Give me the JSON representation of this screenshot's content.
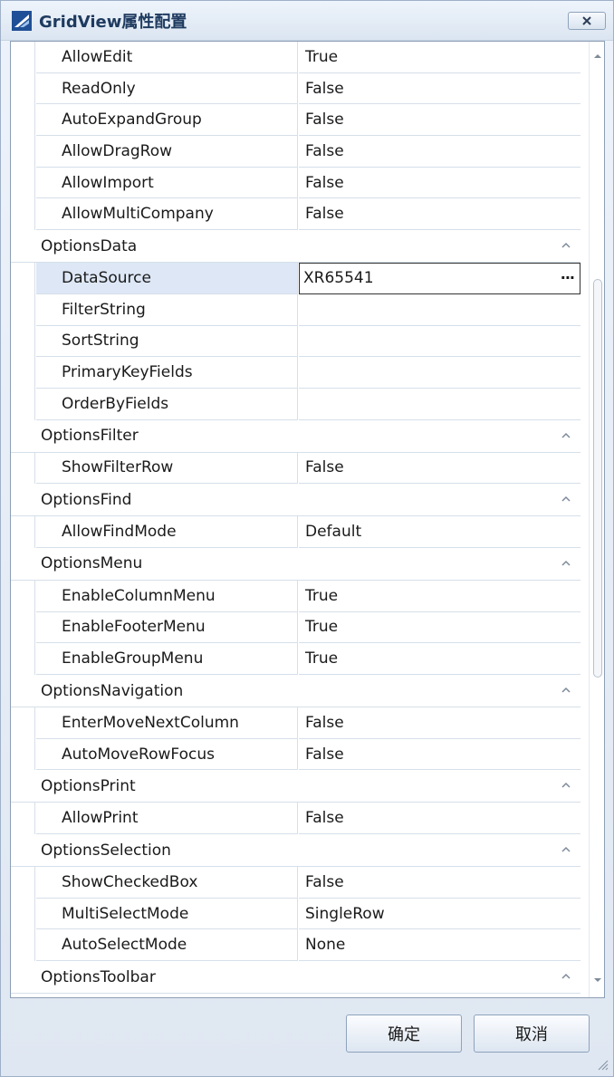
{
  "window": {
    "title": "GridView属性配置"
  },
  "grid": {
    "top_properties": [
      {
        "name": "AllowEdit",
        "value": "True"
      },
      {
        "name": "ReadOnly",
        "value": "False"
      },
      {
        "name": "AutoExpandGroup",
        "value": "False"
      },
      {
        "name": "AllowDragRow",
        "value": "False"
      },
      {
        "name": "AllowImport",
        "value": "False"
      },
      {
        "name": "AllowMultiCompany",
        "value": "False"
      }
    ],
    "categories": [
      {
        "name": "OptionsData",
        "properties": [
          {
            "name": "DataSource",
            "value": "XR65541"
          },
          {
            "name": "FilterString",
            "value": ""
          },
          {
            "name": "SortString",
            "value": ""
          },
          {
            "name": "PrimaryKeyFields",
            "value": ""
          },
          {
            "name": "OrderByFields",
            "value": ""
          }
        ]
      },
      {
        "name": "OptionsFilter",
        "properties": [
          {
            "name": "ShowFilterRow",
            "value": "False"
          }
        ]
      },
      {
        "name": "OptionsFind",
        "properties": [
          {
            "name": "AllowFindMode",
            "value": "Default"
          }
        ]
      },
      {
        "name": "OptionsMenu",
        "properties": [
          {
            "name": "EnableColumnMenu",
            "value": "True"
          },
          {
            "name": "EnableFooterMenu",
            "value": "True"
          },
          {
            "name": "EnableGroupMenu",
            "value": "True"
          }
        ]
      },
      {
        "name": "OptionsNavigation",
        "properties": [
          {
            "name": "EnterMoveNextColumn",
            "value": "False"
          },
          {
            "name": "AutoMoveRowFocus",
            "value": "False"
          }
        ]
      },
      {
        "name": "OptionsPrint",
        "properties": [
          {
            "name": "AllowPrint",
            "value": "False"
          }
        ]
      },
      {
        "name": "OptionsSelection",
        "properties": [
          {
            "name": "ShowCheckedBox",
            "value": "False"
          },
          {
            "name": "MultiSelectMode",
            "value": "SingleRow"
          },
          {
            "name": "AutoSelectMode",
            "value": "None"
          }
        ]
      },
      {
        "name": "OptionsToolbar",
        "properties": []
      }
    ],
    "ellipsis_label": "···"
  },
  "footer": {
    "ok_label": "确定",
    "cancel_label": "取消"
  }
}
